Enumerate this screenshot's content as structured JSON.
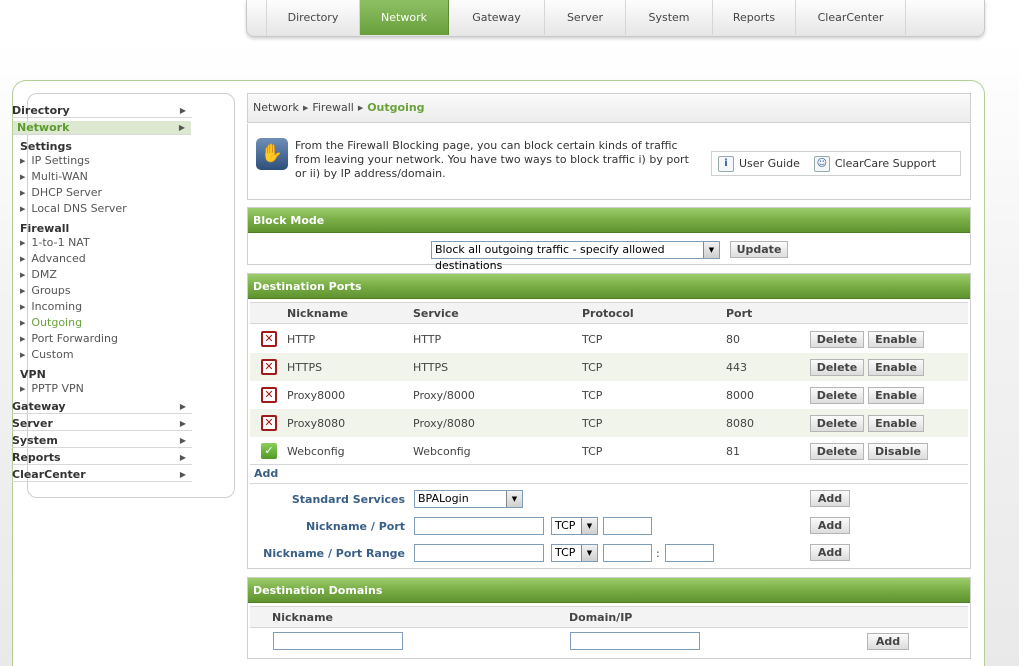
{
  "topnav": {
    "tabs": [
      {
        "label": "Directory"
      },
      {
        "label": "Network"
      },
      {
        "label": "Gateway"
      },
      {
        "label": "Server"
      },
      {
        "label": "System"
      },
      {
        "label": "Reports"
      },
      {
        "label": "ClearCenter"
      }
    ],
    "active": "Network"
  },
  "sidebar": {
    "directory": "Directory",
    "network": "Network",
    "settings_title": "Settings",
    "settings": [
      "IP Settings",
      "Multi-WAN",
      "DHCP Server",
      "Local DNS Server"
    ],
    "firewall_title": "Firewall",
    "firewall": [
      "1-to-1 NAT",
      "Advanced",
      "DMZ",
      "Groups",
      "Incoming",
      "Outgoing",
      "Port Forwarding",
      "Custom"
    ],
    "vpn_title": "VPN",
    "vpn": [
      "PPTP VPN"
    ],
    "gateway": "Gateway",
    "server": "Server",
    "system": "System",
    "reports": "Reports",
    "clearcenter": "ClearCenter"
  },
  "breadcrumb": {
    "crumbs": [
      "Network",
      "Firewall"
    ],
    "current": "Outgoing"
  },
  "info": {
    "text": "From the Firewall Blocking page, you can block certain kinds of traffic from leaving your network.  You have two ways to block traffic i) by port or ii) by IP address/domain.",
    "user_guide": "User Guide",
    "support": "ClearCare Support"
  },
  "block_mode": {
    "title": "Block Mode",
    "selected": "Block all outgoing traffic - specify allowed destinations",
    "update_label": "Update"
  },
  "ports": {
    "title": "Destination Ports",
    "headers": {
      "nickname": "Nickname",
      "service": "Service",
      "protocol": "Protocol",
      "port": "Port"
    },
    "rows": [
      {
        "nickname": "HTTP",
        "service": "HTTP",
        "protocol": "TCP",
        "port": "80",
        "enabled": false,
        "delete": "Delete",
        "toggle": "Enable"
      },
      {
        "nickname": "HTTPS",
        "service": "HTTPS",
        "protocol": "TCP",
        "port": "443",
        "enabled": false,
        "delete": "Delete",
        "toggle": "Enable"
      },
      {
        "nickname": "Proxy8000",
        "service": "Proxy/8000",
        "protocol": "TCP",
        "port": "8000",
        "enabled": false,
        "delete": "Delete",
        "toggle": "Enable"
      },
      {
        "nickname": "Proxy8080",
        "service": "Proxy/8080",
        "protocol": "TCP",
        "port": "8080",
        "enabled": false,
        "delete": "Delete",
        "toggle": "Enable"
      },
      {
        "nickname": "Webconfig",
        "service": "Webconfig",
        "protocol": "TCP",
        "port": "81",
        "enabled": true,
        "delete": "Delete",
        "toggle": "Disable"
      }
    ],
    "add": {
      "title": "Add",
      "standard_label": "Standard Services",
      "standard_selected": "BPALogin",
      "nickport_label": "Nickname / Port",
      "nickrange_label": "Nickname / Port Range",
      "proto_selected": "TCP",
      "range_sep": ":",
      "add_label": "Add"
    }
  },
  "domains": {
    "title": "Destination Domains",
    "headers": {
      "nickname": "Nickname",
      "domain": "Domain/IP"
    },
    "add_label": "Add"
  },
  "colors": {
    "accent_green": "#78ad45",
    "label_blue": "#3a5f86",
    "disabled_red": "#a31a1a"
  }
}
